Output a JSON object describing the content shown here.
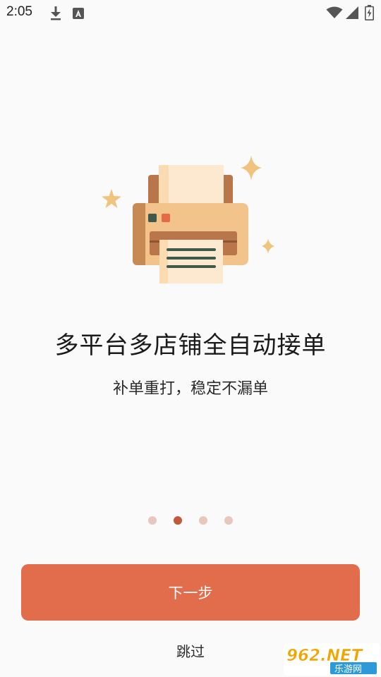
{
  "status_bar": {
    "time": "2:05",
    "icons": [
      "download-icon",
      "a-notification-icon",
      "wifi-icon",
      "signal-icon",
      "battery-icon"
    ]
  },
  "onboarding": {
    "title": "多平台多店铺全自动接单",
    "subtitle": "补单重打，稳定不漏单",
    "page_count": 4,
    "current_page": 2,
    "next_label": "下一步",
    "skip_label": "跳过"
  },
  "watermark": {
    "brand": "962.NET",
    "text": "乐游网"
  },
  "colors": {
    "accent": "#e26d4d",
    "dot_active": "#c2583c",
    "dot_inactive": "#e8c7bf",
    "printer_body": "#f2c48c",
    "printer_dark": "#b8764a",
    "star": "#f0c47f"
  }
}
